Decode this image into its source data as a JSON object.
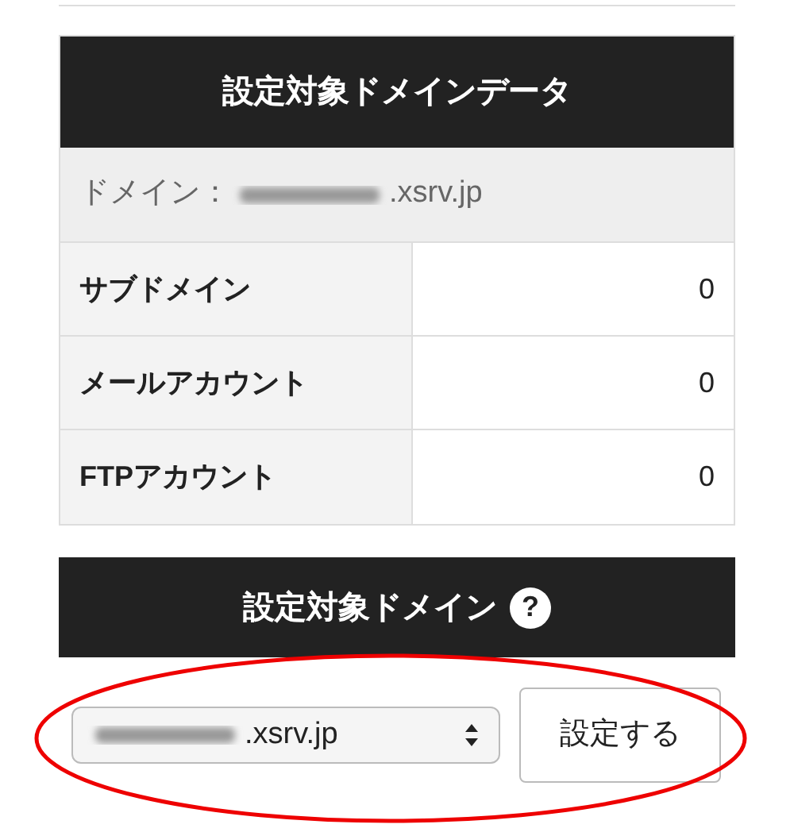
{
  "data_panel": {
    "title": "設定対象ドメインデータ",
    "domain_label": "ドメイン：",
    "domain_suffix": ".xsrv.jp",
    "rows": [
      {
        "label": "サブドメイン",
        "value": "0"
      },
      {
        "label": "メールアカウント",
        "value": "0"
      },
      {
        "label": "FTPアカウント",
        "value": "0"
      }
    ]
  },
  "target_panel": {
    "title": "設定対象ドメイン",
    "help": "?",
    "select_suffix": ".xsrv.jp",
    "button": "設定する"
  }
}
